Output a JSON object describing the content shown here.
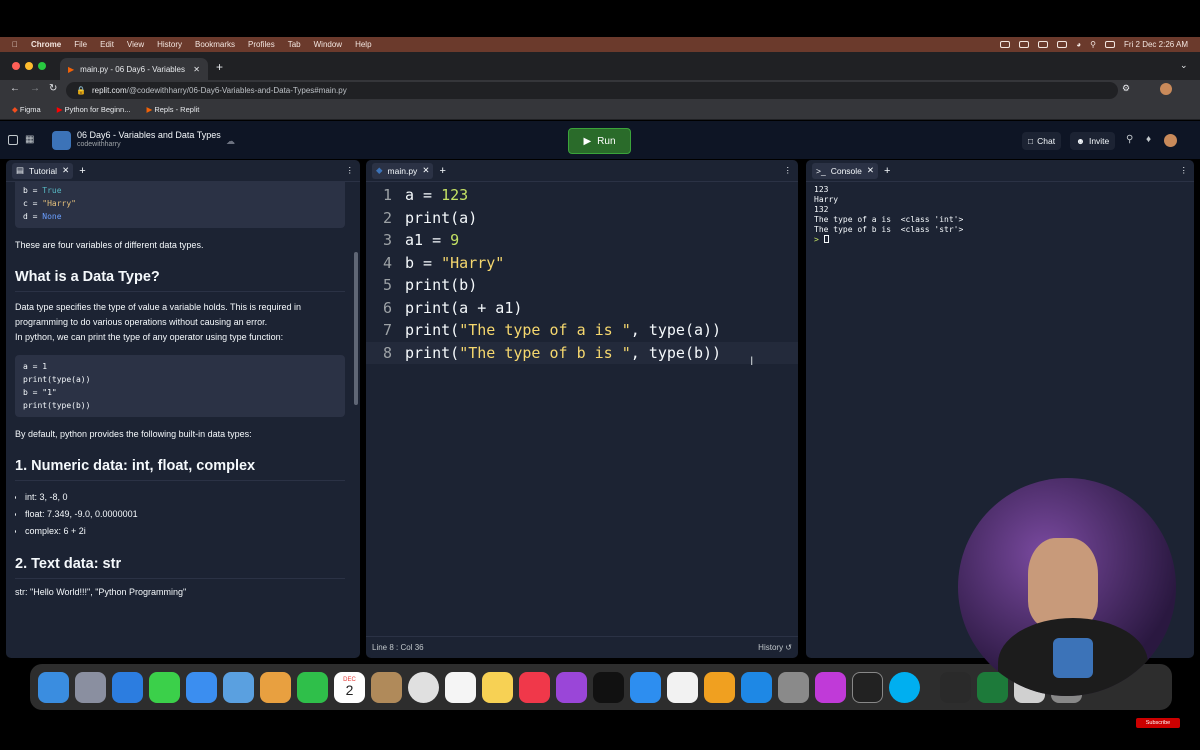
{
  "menubar": {
    "apple": "",
    "app": "Chrome",
    "items": [
      "File",
      "Edit",
      "View",
      "History",
      "Bookmarks",
      "Profiles",
      "Tab",
      "Window",
      "Help"
    ],
    "clock": "Fri 2 Dec  2:26 AM"
  },
  "browser": {
    "tab_title": "main.py - 06 Day6 - Variables",
    "url_host": "replit.com",
    "url_path": "/@codewithharry/06-Day6-Variables-and-Data-Types#main.py",
    "bookmarks": [
      "Figma",
      "Python for Beginn...",
      "Repls - Replit"
    ]
  },
  "replit": {
    "project_title": "06 Day6 - Variables and Data Types",
    "project_owner": "codewithharry",
    "run_label": "Run",
    "chat_label": "Chat",
    "invite_label": "Invite"
  },
  "tutorial": {
    "tab_label": "Tutorial",
    "code_top": [
      [
        "b",
        " = ",
        "True"
      ],
      [
        "c",
        " = ",
        "\"Harry\""
      ],
      [
        "d",
        " = ",
        "None"
      ]
    ],
    "p1": "These are four variables of different data types.",
    "h_datatype": "What is a Data Type?",
    "p2a": "Data type specifies the type of value a variable holds. This is required in programming to do various operations without causing an error.",
    "p2b": "In python, we can print the type of any operator using type function:",
    "code2": [
      "a = 1",
      "print(type(a))",
      "b = \"1\"",
      "print(type(b))"
    ],
    "p3": "By default, python provides the following built-in data types:",
    "h_numeric": "1. Numeric data: int, float, complex",
    "numeric_items": [
      "int: 3, -8, 0",
      "float: 7.349, -9.0, 0.0000001",
      "complex: 6 + 2i"
    ],
    "h_text": "2. Text data: str",
    "p4": "str: \"Hello World!!!\", \"Python Programming\""
  },
  "editor": {
    "tab_label": "main.py",
    "status": "Line 8 : Col 36",
    "history_label": "History",
    "lines": [
      {
        "n": "1",
        "parts": [
          [
            "a = ",
            ""
          ],
          [
            "123",
            "c-num"
          ]
        ]
      },
      {
        "n": "2",
        "parts": [
          [
            "print(a)",
            ""
          ]
        ]
      },
      {
        "n": "3",
        "parts": [
          [
            "a1 = ",
            ""
          ],
          [
            "9",
            "c-num"
          ]
        ]
      },
      {
        "n": "4",
        "parts": [
          [
            "b = ",
            ""
          ],
          [
            "\"Harry\"",
            "c-str"
          ]
        ]
      },
      {
        "n": "5",
        "parts": [
          [
            "print(b)",
            ""
          ]
        ]
      },
      {
        "n": "6",
        "parts": [
          [
            "print(a + a1)",
            ""
          ]
        ]
      },
      {
        "n": "7",
        "parts": [
          [
            "print(",
            ""
          ],
          [
            "\"The type of a is \"",
            "c-str"
          ],
          [
            ", type(a))",
            ""
          ]
        ]
      },
      {
        "n": "8",
        "parts": [
          [
            "print(",
            ""
          ],
          [
            "\"The type of b is \"",
            "c-str"
          ],
          [
            ", type(b))",
            ""
          ]
        ]
      }
    ]
  },
  "console": {
    "tab_label": "Console",
    "output": [
      "123",
      "Harry",
      "132",
      "The type of a is  <class 'int'>",
      "The type of b is  <class 'str'>"
    ],
    "prompt": ">"
  },
  "dock": {
    "calendar_month": "DEC",
    "calendar_day": "2",
    "subscribe": "Subscribe"
  },
  "colors": {
    "accent_run": "#2a6b2a",
    "replit_bg": "#0e1525",
    "pane_bg": "#1c2333"
  }
}
